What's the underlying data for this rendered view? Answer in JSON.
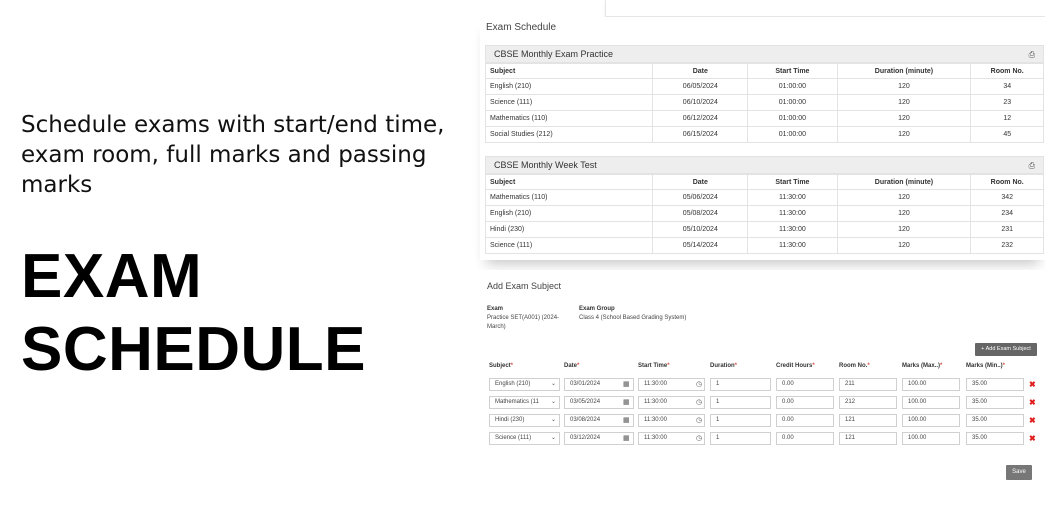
{
  "promo": {
    "description": "Schedule exams with start/end time, exam room, full marks and passing marks",
    "title": "EXAM SCHEDULE"
  },
  "exam_schedule": {
    "title": "Exam Schedule",
    "columns": [
      "Subject",
      "Date",
      "Start Time",
      "Duration (minute)",
      "Room No."
    ],
    "groups": [
      {
        "name": "CBSE Monthly Exam Practice",
        "rows": [
          [
            "English (210)",
            "06/05/2024",
            "01:00:00",
            "120",
            "34"
          ],
          [
            "Science (111)",
            "06/10/2024",
            "01:00:00",
            "120",
            "23"
          ],
          [
            "Mathematics (110)",
            "06/12/2024",
            "01:00:00",
            "120",
            "12"
          ],
          [
            "Social Studies (212)",
            "06/15/2024",
            "01:00:00",
            "120",
            "45"
          ]
        ]
      },
      {
        "name": "CBSE Monthly Week Test",
        "rows": [
          [
            "Mathematics (110)",
            "05/06/2024",
            "11:30:00",
            "120",
            "342"
          ],
          [
            "English (210)",
            "05/08/2024",
            "11:30:00",
            "120",
            "234"
          ],
          [
            "Hindi (230)",
            "05/10/2024",
            "11:30:00",
            "120",
            "231"
          ],
          [
            "Science (111)",
            "05/14/2024",
            "11:30:00",
            "120",
            "232"
          ]
        ]
      }
    ],
    "print_icon": "printer-icon"
  },
  "add_subject": {
    "title": "Add Exam Subject",
    "exam_label": "Exam",
    "exam_value": "Practice SET(A001) (2024-March)",
    "group_label": "Exam Group",
    "group_value": "Class 4 (School Based Grading System)",
    "add_button": "+ Add Exam Subject",
    "headers": {
      "subject": "Subject",
      "date": "Date",
      "start_time": "Start Time",
      "duration": "Duration",
      "credit_hours": "Credit Hours",
      "room_no": "Room No.",
      "marks_max": "Marks (Max..)",
      "marks_min": "Marks (Min..)",
      "required_mark": "*"
    },
    "rows": [
      {
        "subject": "English (210)",
        "date": "03/01/2024",
        "start_time": "11:30:00",
        "duration": "1",
        "credit_hours": "0.00",
        "room_no": "211",
        "marks_max": "100.00",
        "marks_min": "35.00"
      },
      {
        "subject": "Mathematics (11",
        "date": "03/05/2024",
        "start_time": "11:30:00",
        "duration": "1",
        "credit_hours": "0.00",
        "room_no": "212",
        "marks_max": "100.00",
        "marks_min": "35.00"
      },
      {
        "subject": "Hindi (230)",
        "date": "03/08/2024",
        "start_time": "11:30:00",
        "duration": "1",
        "credit_hours": "0.00",
        "room_no": "121",
        "marks_max": "100.00",
        "marks_min": "35.00"
      },
      {
        "subject": "Science (111)",
        "date": "03/12/2024",
        "start_time": "11:30:00",
        "duration": "1",
        "credit_hours": "0.00",
        "room_no": "121",
        "marks_max": "100.00",
        "marks_min": "35.00"
      }
    ],
    "delete_icon": "✖",
    "save_button": "Save"
  },
  "colors": {
    "header_bg": "#eeeeee",
    "button_bg": "#666666",
    "required": "#d9534f",
    "delete": "#e02020"
  }
}
